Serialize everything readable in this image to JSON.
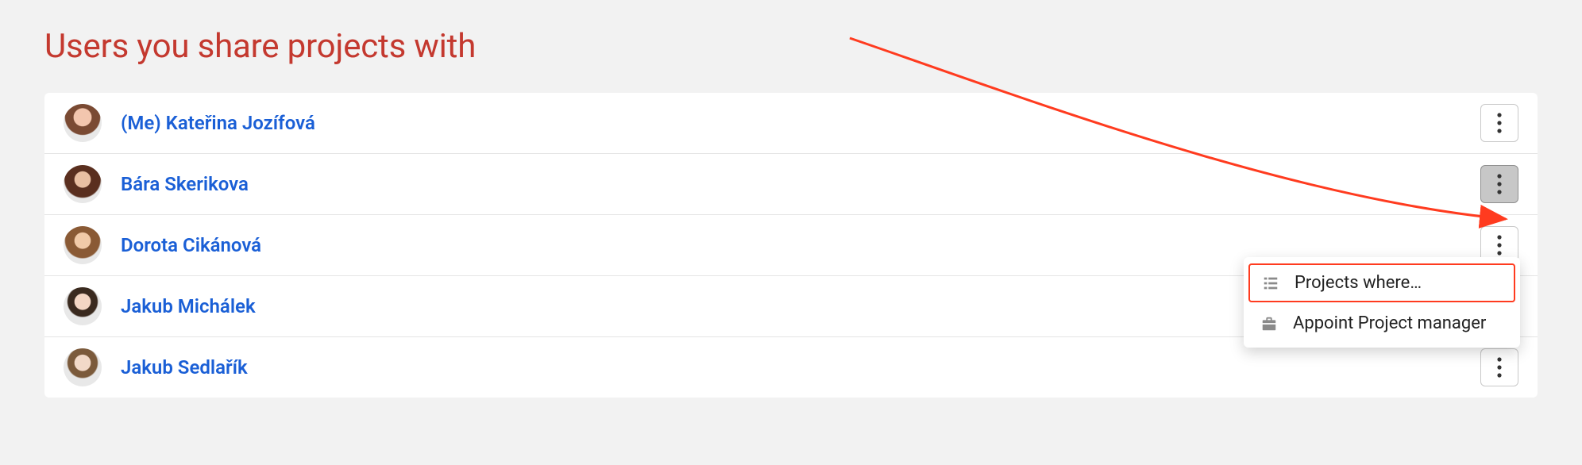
{
  "page_title": "Users you share projects with",
  "users": [
    {
      "me_prefix": "(Me) ",
      "name": "Kateřina Jozífová",
      "more_active": false
    },
    {
      "me_prefix": "",
      "name": "Bára Skerikova",
      "more_active": true
    },
    {
      "me_prefix": "",
      "name": "Dorota Cikánová",
      "more_active": false
    },
    {
      "me_prefix": "",
      "name": "Jakub Michálek",
      "more_active": false
    },
    {
      "me_prefix": "",
      "name": "Jakub Sedlařík",
      "more_active": false
    }
  ],
  "dropdown": {
    "items": [
      {
        "label": "Projects where…",
        "icon": "list-icon",
        "highlight": true
      },
      {
        "label": "Appoint Project manager",
        "icon": "briefcase-icon",
        "highlight": false
      }
    ]
  },
  "annotation": {
    "arrow_color": "#ff3b1f"
  }
}
